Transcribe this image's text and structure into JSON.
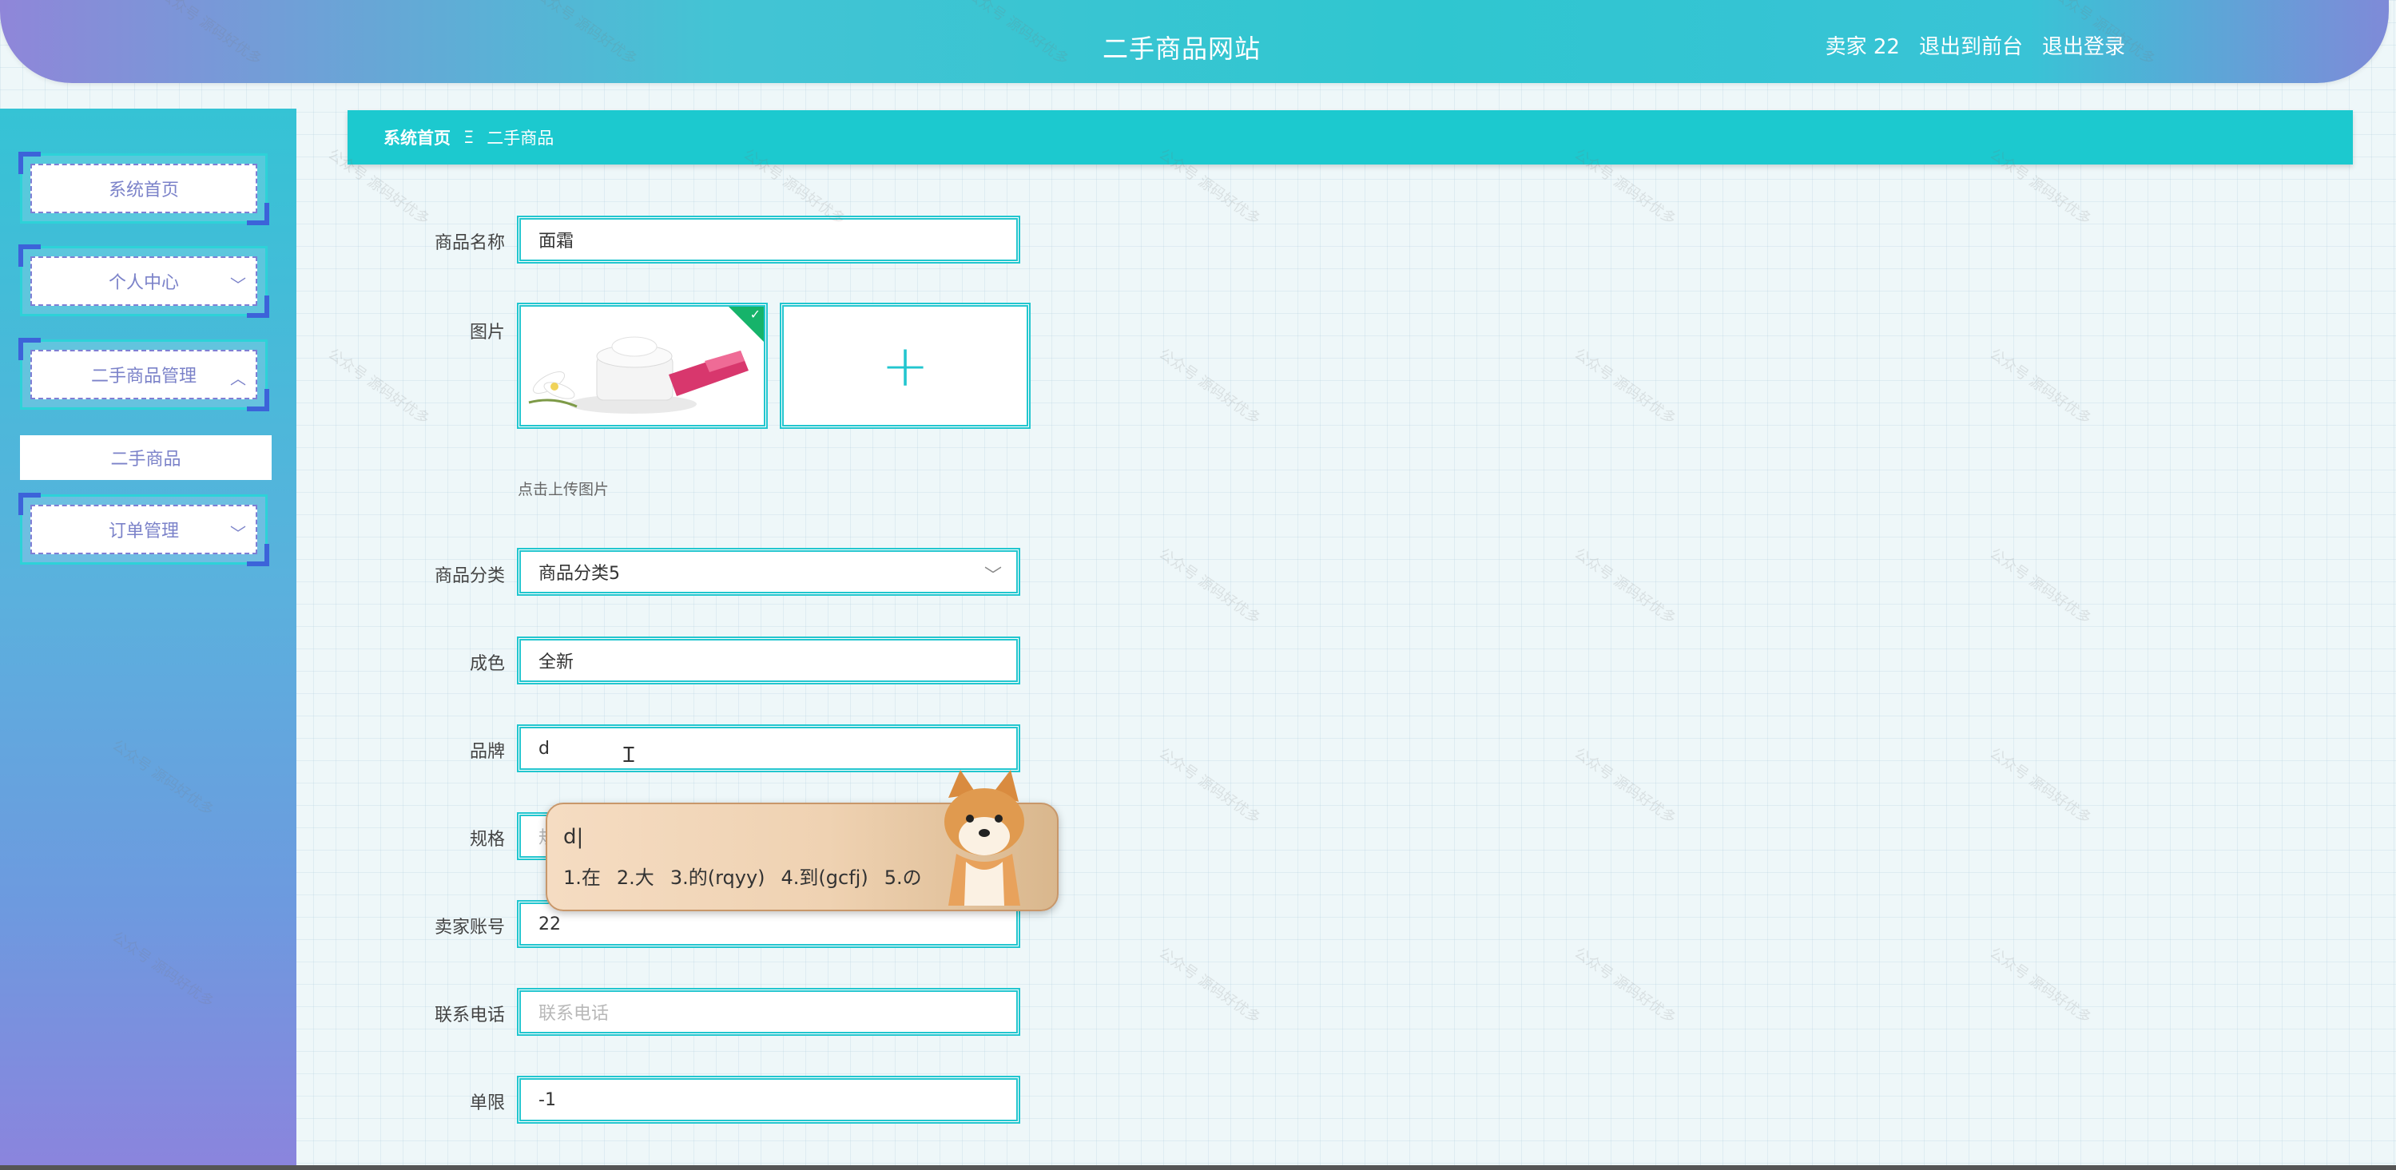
{
  "header": {
    "title": "二手商品网站",
    "user": "卖家 22",
    "to_front": "退出到前台",
    "logout": "退出登录"
  },
  "sidebar": {
    "items": [
      {
        "label": "系统首页"
      },
      {
        "label": "个人中心"
      },
      {
        "label": "二手商品管理"
      },
      {
        "label": "订单管理"
      }
    ],
    "submenu_active": "二手商品"
  },
  "breadcrumb": {
    "home": "系统首页",
    "separator": "Ξ",
    "current": "二手商品"
  },
  "form": {
    "name_label": "商品名称",
    "name_value": "面霜",
    "image_label": "图片",
    "upload_hint": "点击上传图片",
    "category_label": "商品分类",
    "category_value": "商品分类5",
    "condition_label": "成色",
    "condition_value": "全新",
    "brand_label": "品牌",
    "brand_value": "d",
    "spec_label": "规格",
    "spec_placeholder": "规格",
    "seller_label": "卖家账号",
    "seller_value": "22",
    "phone_label": "联系电话",
    "phone_placeholder": "联系电话",
    "limit_label": "单限",
    "limit_value": "-1"
  },
  "ime": {
    "typed": "d|",
    "candidates": [
      "1.在",
      "2.大",
      "3.的(rqyy)",
      "4.到(gcfj)",
      "5.の"
    ]
  },
  "watermark_text": "公众号 源码好优多"
}
